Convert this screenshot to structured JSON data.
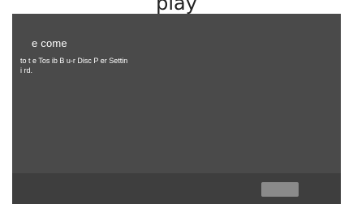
{
  "top_text": "play",
  "wizard": {
    "title": "e come",
    "description": "to t e Tos ib B u-r Disc P er Settin\ni rd."
  },
  "footer": {
    "button_label": ""
  },
  "colors": {
    "window_background": "#4a4a4a",
    "footer_background": "#3e3e3e",
    "button_background": "#8a8a8a",
    "text": "#ffffff"
  }
}
